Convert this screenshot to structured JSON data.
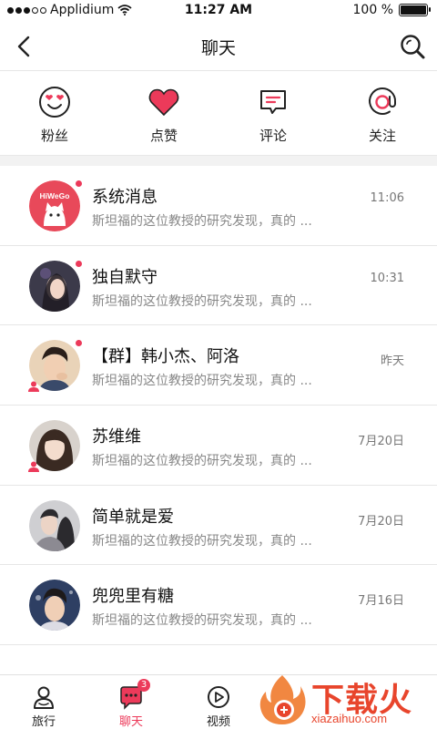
{
  "status_bar": {
    "carrier": "Applidium",
    "time": "11:27 AM",
    "battery": "100 %",
    "battery_level": 1.0
  },
  "header": {
    "title": "聊天",
    "back_icon": "chevron-left-icon",
    "search_icon": "search-icon"
  },
  "quick_actions": [
    {
      "label": "粉丝",
      "icon": "heart-eyes-face-icon"
    },
    {
      "label": "点赞",
      "icon": "heart-icon"
    },
    {
      "label": "评论",
      "icon": "comment-icon"
    },
    {
      "label": "关注",
      "icon": "at-sign-icon"
    }
  ],
  "messages": [
    {
      "name": "系统消息",
      "preview": "斯坦福的这位教授的研究发现，真的 ...",
      "time": "11:06",
      "avatar_text": "HiWeGo"
    },
    {
      "name": "独自默守",
      "preview": "斯坦福的这位教授的研究发现，真的 ...",
      "time": "10:31"
    },
    {
      "name": "【群】韩小杰、阿洛",
      "preview": "斯坦福的这位教授的研究发现，真的 ...",
      "time": "昨天"
    },
    {
      "name": "苏维维",
      "preview": "斯坦福的这位教授的研究发现，真的 ...",
      "time": "7月20日"
    },
    {
      "name": "简单就是爱",
      "preview": "斯坦福的这位教授的研究发现，真的 ...",
      "time": "7月20日"
    },
    {
      "name": "兜兜里有糖",
      "preview": "斯坦福的这位教授的研究发现，真的 ...",
      "time": "7月16日"
    }
  ],
  "tab_bar": {
    "tabs": [
      {
        "label": "旅行",
        "icon": "person-icon"
      },
      {
        "label": "聊天",
        "icon": "chat-bubble-icon",
        "badge": "3"
      },
      {
        "label": "视频",
        "icon": "play-circle-icon"
      }
    ]
  },
  "watermark": {
    "main": "下载火",
    "sub": "xiazaihuo.com"
  },
  "colors": {
    "accent": "#ec3a5a",
    "watermark": "#e8452c"
  }
}
